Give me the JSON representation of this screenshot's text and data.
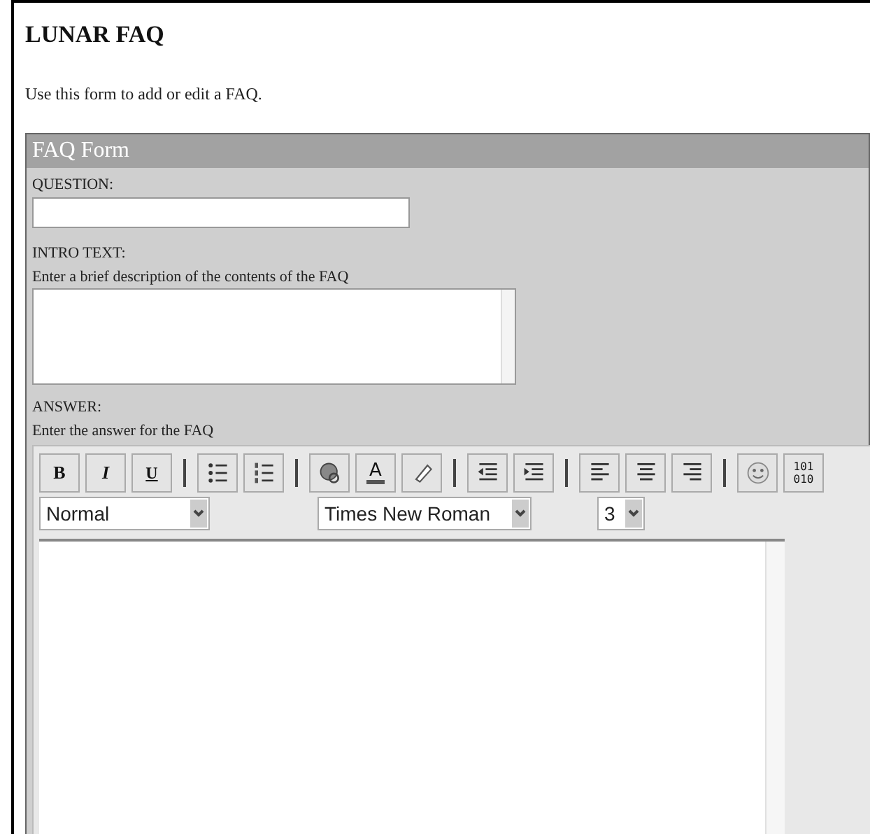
{
  "page": {
    "title": "LUNAR FAQ",
    "intro": "Use this form to add or edit a FAQ."
  },
  "form": {
    "title": "FAQ Form",
    "question": {
      "label": "QUESTION:"
    },
    "intro_text": {
      "label": "INTRO TEXT:",
      "hint": "Enter a brief description of the contents of the FAQ"
    },
    "answer": {
      "label": "ANSWER:",
      "hint": "Enter the answer for the FAQ"
    }
  },
  "editor": {
    "toolbar": [
      {
        "kind": "bold",
        "label": "B"
      },
      {
        "kind": "italic",
        "label": "I"
      },
      {
        "kind": "underline",
        "label": "U"
      },
      {
        "kind": "separator"
      },
      {
        "kind": "bullet-list"
      },
      {
        "kind": "numbered-list"
      },
      {
        "kind": "separator"
      },
      {
        "kind": "link"
      },
      {
        "kind": "font-color",
        "label": "A"
      },
      {
        "kind": "highlight"
      },
      {
        "kind": "separator"
      },
      {
        "kind": "outdent"
      },
      {
        "kind": "indent"
      },
      {
        "kind": "separator"
      },
      {
        "kind": "align-left"
      },
      {
        "kind": "align-center"
      },
      {
        "kind": "align-right"
      },
      {
        "kind": "separator"
      },
      {
        "kind": "smiley"
      },
      {
        "kind": "source",
        "label": "101 010"
      }
    ],
    "selects": [
      {
        "kind": "format",
        "value": "Normal"
      },
      {
        "kind": "font",
        "value": "Times New Roman"
      },
      {
        "kind": "size",
        "value": "3"
      }
    ]
  }
}
